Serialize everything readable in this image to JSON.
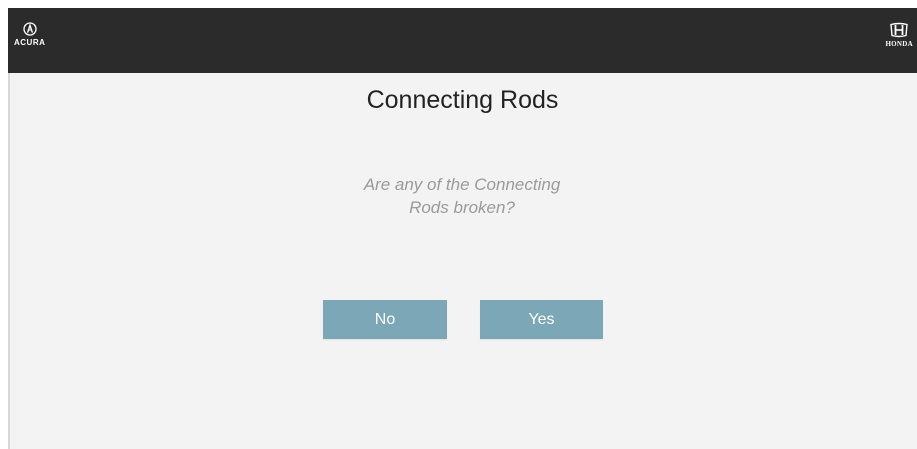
{
  "header": {
    "left_logo": {
      "icon": "acura-logo-icon",
      "text": "ACURA"
    },
    "right_logo": {
      "icon": "honda-logo-icon",
      "text": "HONDA"
    }
  },
  "main": {
    "title": "Connecting Rods",
    "question_lines": [
      "Are any of the Connecting",
      "Rods broken?"
    ],
    "buttons": {
      "no_label": "No",
      "yes_label": "Yes"
    }
  },
  "colors": {
    "header_bg": "#2b2b2b",
    "page_bg": "#f3f3f3",
    "button_bg": "#7ba7b6",
    "button_text": "#ffffff",
    "question_text": "#9a9a9a",
    "title_text": "#222222"
  }
}
